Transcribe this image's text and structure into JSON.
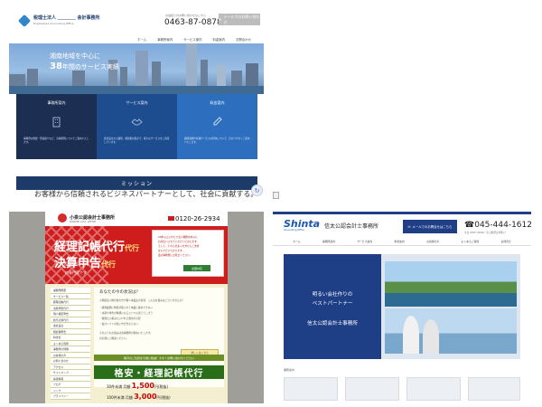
{
  "shot1": {
    "logo_title": "税理士法人 ＿＿＿＿ 会計事務所",
    "logo_sub": "Engineered Accounting Office",
    "tel_caption": "お電話でのお問い合わせはこちら",
    "tel": "0463-87-0878",
    "contact_label": "メールでのお問い合わせ",
    "nav": [
      "ホーム",
      "事務所案内",
      "サービス案内",
      "料金案内",
      "お問合わせ"
    ],
    "hero_line1": "湘南地域を中心に",
    "hero_line2_num": "38",
    "hero_line2_rest": "年間のサービス実績",
    "cards": [
      {
        "title": "事務所案内",
        "desc": "事務所の概要・所員紹介など、当事務所についてご案内いたします。"
      },
      {
        "title": "サービス案内",
        "desc": "会社設立から顧問、相続税対策まで、様々なサービスをご用意しています。"
      },
      {
        "title": "料金案内",
        "desc": "顧問報酬や各種サービスの料金について、分かりやすくご案内いたします。"
      }
    ],
    "mission": "ミッション",
    "colors": {
      "accent": "#1d3b69",
      "card1": "#1c2e52",
      "card2": "#1d4d8f",
      "card3": "#2d6fbe"
    }
  },
  "caption1": "お客様から信頼されるビジネスパートナーとして、社会に貢献する。",
  "shot2": {
    "logo_title": "小泉公認会計士事務所",
    "logo_sub": "KOIZUMI C.P.A. OFFICE",
    "tel": "0120-26-2934",
    "banner_t1": "経理記帳代行",
    "banner_t1_tag": "代行",
    "banner_t2": "決算申告",
    "banner_t2_tag": "代行",
    "banner_sub": "の専門家です",
    "side_box": [
      "20年以上にわたり法人税務を中心に",
      "お手伝いさせていただいております。",
      "そして、それらの多くの方からご支持",
      "をいただいております。",
      "会計事務所にお任せください。"
    ],
    "side_btn": "全国対応",
    "sidebar": [
      "事務所概要",
      "サービス一覧",
      "経理記帳代行",
      "決算申告代行",
      "個人確定申告",
      "給与計算代行",
      "会社設立",
      "相続税申告",
      "料金表",
      "よくある質問",
      "事務所の特徴",
      "お客様の声",
      "お問い合わせ",
      "アクセス",
      "サイトマップ",
      "採用情報",
      "ブログ",
      "リンク",
      "プライバシー"
    ],
    "main_heading": "あなたの今の状況は？",
    "main_paras": [
      "小規模法人経営者の方や個人事業主の皆様、こんなお悩みはございませんか？",
      "・経理業務に時間が取られて本業に集中できない",
      "・決算や申告の時期になるといつも慌ててしまう",
      "・税理士に頼みたいけれど費用が心配",
      "・会計ソフトの使い方が分からない",
      "そのようなお悩みは当事務所が解決いたします。",
      "お気軽にご相談ください。"
    ],
    "main_btn": "詳しくはこちら",
    "green_band": "毎月のご負担を大幅に削減！今すぐお問い合わせください",
    "green_bar": "格安・経理記帳代行",
    "price_rows": [
      {
        "label": "30件未満",
        "unit": "月額",
        "price": "1,500",
        "yen": "円(税抜)"
      },
      {
        "label": "100件未満",
        "unit": "月額",
        "price": "3,000",
        "yen": "円(税抜)"
      }
    ],
    "colors": {
      "red": "#cf1d1d",
      "green": "#2a6e1a",
      "bg": "#f3efd0"
    }
  },
  "shot3": {
    "logo": "Shinta",
    "logo_sub": "Accounting Office",
    "office": "信太公認会計士事務所",
    "mail_btn": "メールでのお問合せはこちら",
    "tel": "045-444-1612",
    "hours": "平日 9:00〜18:00（土日祝祭日を除く）",
    "nav": [
      "ホーム",
      "事務所案内",
      "サービス案内",
      "料金案内",
      "お客様の声",
      "よくあるご質問",
      "お問合せ"
    ],
    "hero_l1": "明るい会社作りの",
    "hero_l2": "ベストパートナー",
    "hero_l3": "信太公認会計士事務所",
    "section_label": "業務案内",
    "colors": {
      "navy": "#1e3f86",
      "brand": "#1b57b5"
    }
  }
}
